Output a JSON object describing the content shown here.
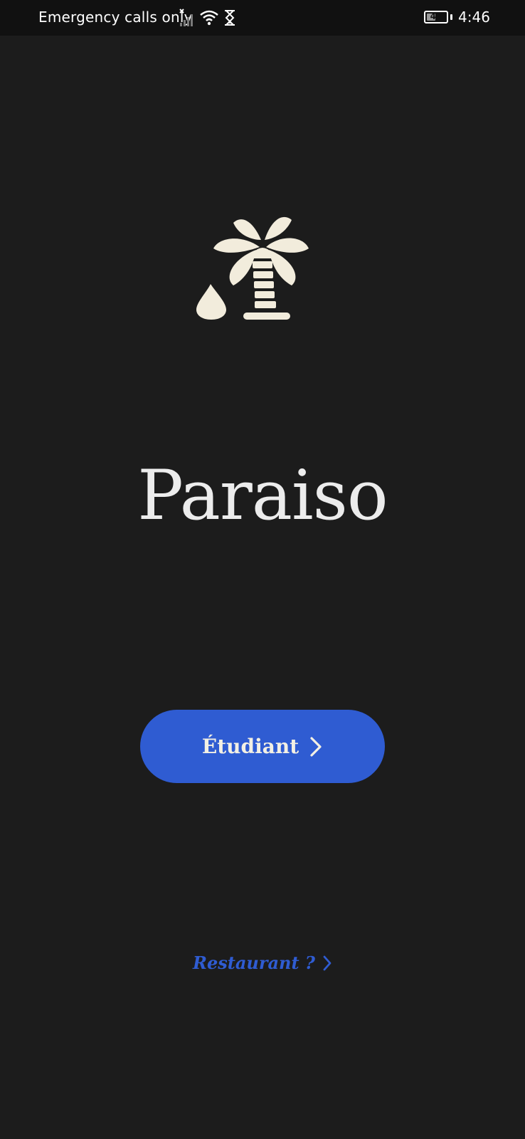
{
  "status_bar": {
    "carrier_text": "Emergency calls only",
    "battery_level": "47",
    "battery_fraction": 0.47,
    "time": "4:46",
    "icons": [
      "no-signal-icon",
      "wifi-icon",
      "hourglass-icon",
      "battery-icon"
    ]
  },
  "app": {
    "logo_icon": "palm-tree-icon",
    "name": "Paraiso",
    "logo_color": "#f2ecdc"
  },
  "actions": {
    "primary_label": "Étudiant",
    "primary_color": "#2f5cd2",
    "secondary_label": "Restaurant ?",
    "secondary_color": "#2f5cd2"
  },
  "theme": {
    "background": "#1c1c1c"
  }
}
